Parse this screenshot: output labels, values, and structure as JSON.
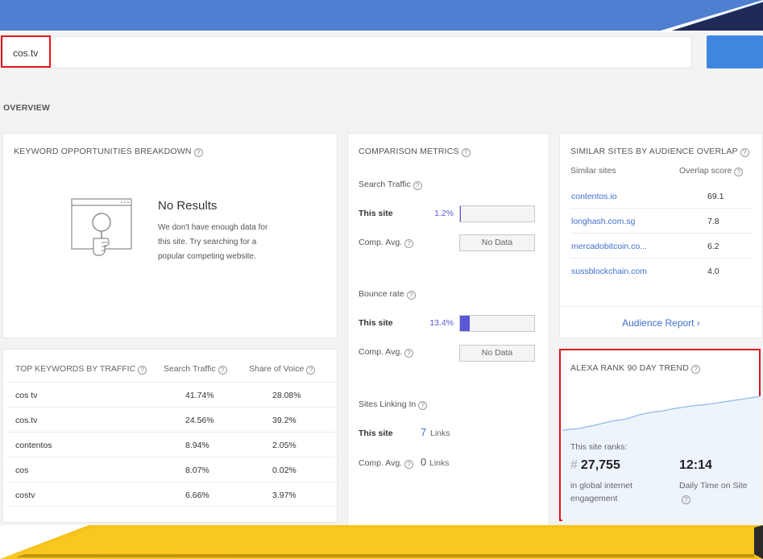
{
  "search": {
    "value": "cos.tv"
  },
  "overview_label": "OVERVIEW",
  "help_glyph": "?",
  "keyword_opportunities": {
    "title": "KEYWORD OPPORTUNITIES BREAKDOWN",
    "no_results_title": "No Results",
    "no_results_text": "We don't have enough data for this site. Try searching for a popular competing website."
  },
  "top_keywords": {
    "title": "TOP KEYWORDS BY TRAFFIC",
    "col_traffic": "Search Traffic",
    "col_share": "Share of Voice",
    "rows": [
      {
        "keyword": "cos tv",
        "traffic": "41.74%",
        "share": "28.08%"
      },
      {
        "keyword": "cos.tv",
        "traffic": "24.56%",
        "share": "39.2%"
      },
      {
        "keyword": "contentos",
        "traffic": "8.94%",
        "share": "2.05%"
      },
      {
        "keyword": "cos",
        "traffic": "8.07%",
        "share": "0.02%"
      },
      {
        "keyword": "costv",
        "traffic": "6.66%",
        "share": "3.97%"
      }
    ]
  },
  "comparison": {
    "title": "COMPARISON METRICS",
    "this_site": "This site",
    "comp_avg": "Comp. Avg.",
    "no_data": "No Data",
    "search_traffic": {
      "label": "Search Traffic",
      "value": "1.2%",
      "fraction": 0.012
    },
    "bounce_rate": {
      "label": "Bounce rate",
      "value": "13.4%",
      "fraction": 0.134
    },
    "linking": {
      "label": "Sites Linking In",
      "this_value": "7",
      "comp_value": "0",
      "unit": "Links"
    }
  },
  "similar_sites": {
    "title": "SIMILAR SITES BY AUDIENCE OVERLAP",
    "col_site": "Similar sites",
    "col_score": "Overlap score",
    "rows": [
      {
        "site": "contentos.io",
        "score": "69.1"
      },
      {
        "site": "longhash.com.sg",
        "score": "7.8"
      },
      {
        "site": "mercadobitcoin.co...",
        "score": "6.2"
      },
      {
        "site": "sussblockchain.com",
        "score": "4.0"
      }
    ],
    "audience_link": "Audience Report ›"
  },
  "alexa": {
    "title": "ALEXA RANK 90 DAY TREND",
    "ranks_label": "This site ranks:",
    "hash": "#",
    "rank": "27,755",
    "rank_caption": "in global internet engagement",
    "time": "12:14",
    "time_caption": "Daily Time on Site",
    "colors": {
      "line": "#8fb8e8",
      "fill": "#eef4fc",
      "highlight": "#e3141b"
    }
  },
  "colors": {
    "header_blue": "#4f7fd1",
    "link_blue": "#3f6fd0",
    "bar_purple": "#5a58d6",
    "band_gold": "#f7c21a"
  }
}
